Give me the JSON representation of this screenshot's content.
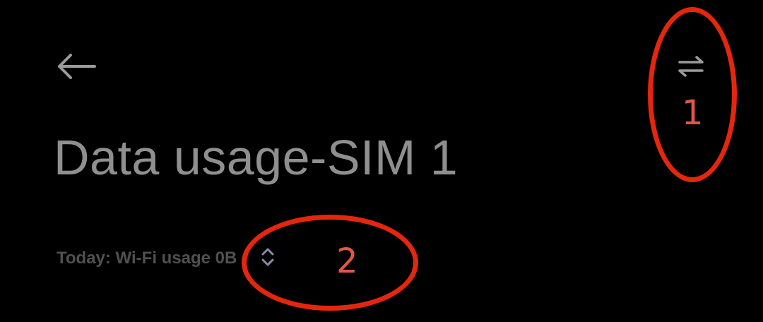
{
  "header": {
    "back_icon": "arrow-left-icon",
    "switch_icon": "swap-arrows-icon",
    "title": "Data usage-SIM 1"
  },
  "usage": {
    "summary_text": "Today: Wi-Fi usage 0B",
    "toggle_icon": "chevron-up-down-icon"
  },
  "annotations": {
    "label_1": "1",
    "label_2": "2",
    "color": "#e5260f"
  },
  "colors": {
    "background": "#000000",
    "title": "#8f8f8f",
    "secondary_text": "#505050",
    "icon": "#9a9a9a",
    "toggle_icon": "#8a8aa8"
  }
}
